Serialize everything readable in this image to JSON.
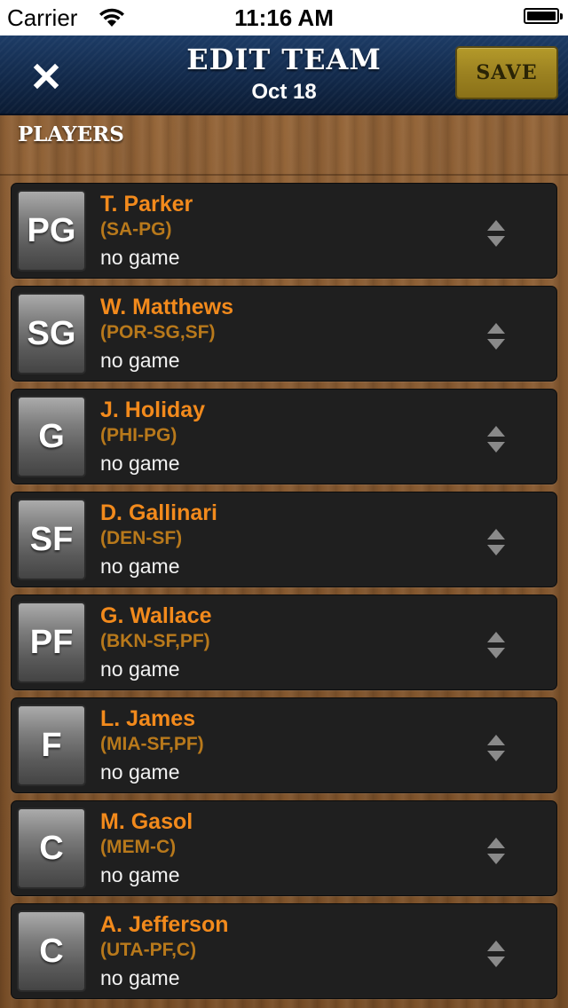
{
  "status_bar": {
    "carrier": "Carrier",
    "time": "11:16 AM"
  },
  "nav": {
    "title": "EDIT TEAM",
    "subtitle": "Oct 18",
    "save_label": "SAVE",
    "close_icon": "close-x-icon",
    "colors": {
      "bar": "#12294a",
      "save": "#9c8221"
    }
  },
  "section": {
    "title": "PLAYERS"
  },
  "players": [
    {
      "position": "PG",
      "name": "T. Parker",
      "team": "(SA-PG)",
      "status": "no game"
    },
    {
      "position": "SG",
      "name": "W. Matthews",
      "team": "(POR-SG,SF)",
      "status": "no game"
    },
    {
      "position": "G",
      "name": "J. Holiday",
      "team": "(PHI-PG)",
      "status": "no game"
    },
    {
      "position": "SF",
      "name": "D. Gallinari",
      "team": "(DEN-SF)",
      "status": "no game"
    },
    {
      "position": "PF",
      "name": "G. Wallace",
      "team": "(BKN-SF,PF)",
      "status": "no game"
    },
    {
      "position": "F",
      "name": "L. James",
      "team": "(MIA-SF,PF)",
      "status": "no game"
    },
    {
      "position": "C",
      "name": "M. Gasol",
      "team": "(MEM-C)",
      "status": "no game"
    },
    {
      "position": "C",
      "name": "A. Jefferson",
      "team": "(UTA-PF,C)",
      "status": "no game"
    }
  ],
  "colors": {
    "name": "#f28a1c",
    "team": "#b8791b",
    "row_bg": "#1f1f1f"
  }
}
